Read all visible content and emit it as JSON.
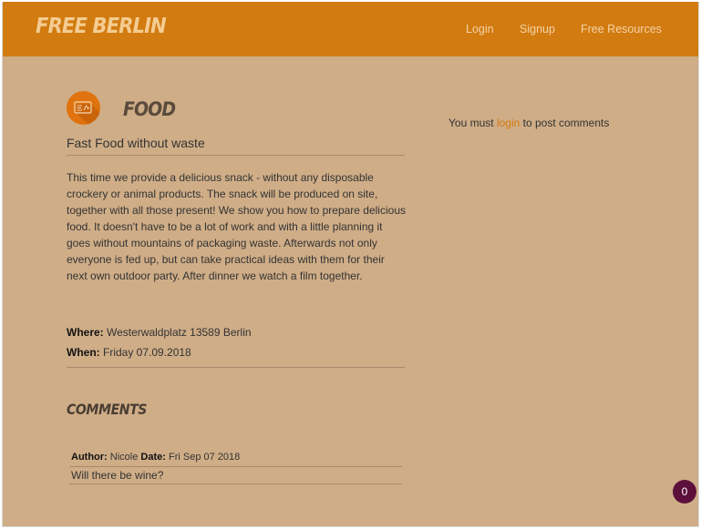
{
  "navbar": {
    "brand": "FREE BERLIN",
    "links": [
      {
        "label": "Login"
      },
      {
        "label": "Signup"
      },
      {
        "label": "Free Resources"
      }
    ]
  },
  "event": {
    "category": "FOOD",
    "title": "Fast Food without waste",
    "description": "This time we provide a delicious snack - without any disposable crockery or animal products. The snack will be produced on site, together with all those present! We show you how to prepare delicious food. It doesn't have to be a lot of work and with a little planning it goes without mountains of packaging waste. Afterwards not only everyone is fed up, but can take practical ideas with them for their next own outdoor party. After dinner we watch a film together.",
    "where_label": "Where:",
    "where_value": "Westerwaldplatz 13589 Berlin",
    "when_label": "When:",
    "when_value": "Friday 07.09.2018"
  },
  "comments": {
    "heading": "COMMENTS",
    "items": [
      {
        "author_label": "Author:",
        "author": "Nicole",
        "date_label": "Date:",
        "date": "Fri Sep 07 2018",
        "text": "Will there be wine?"
      }
    ]
  },
  "sidebar": {
    "prefix": "You must",
    "link": "login",
    "suffix": "to post comments"
  },
  "badge": {
    "count": "0"
  },
  "colors": {
    "header": "#d27b10",
    "background": "#cfad87",
    "brand_text": "#f4cc92",
    "link": "#d27b10",
    "badge": "#5d0f3c"
  }
}
